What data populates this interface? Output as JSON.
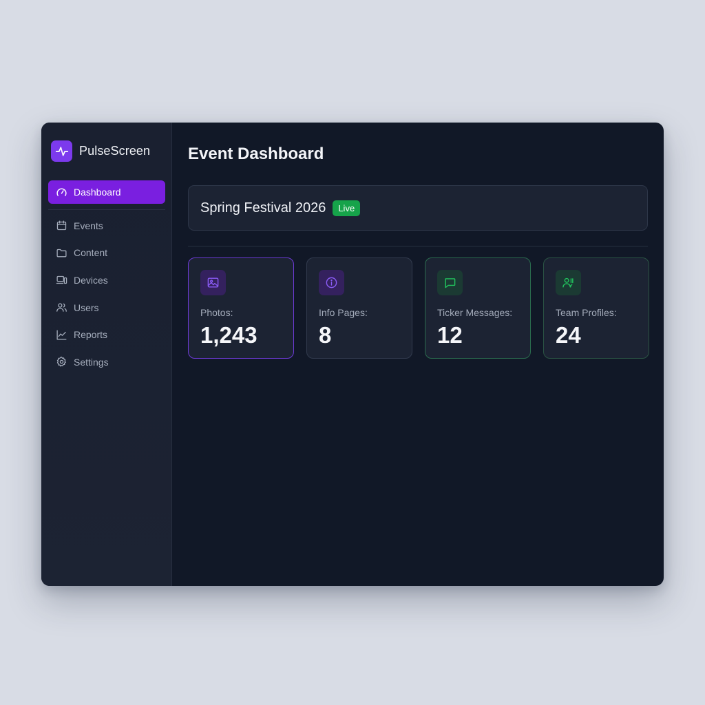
{
  "app": {
    "name": "PulseScreen",
    "logo_icon": "pulse-icon",
    "accent_color": "#7c3aed"
  },
  "sidebar": {
    "active_item": {
      "label": "Dashboard",
      "icon": "gauge-icon"
    },
    "items": [
      {
        "label": "Events",
        "icon": "calendar-icon"
      },
      {
        "label": "Content",
        "icon": "folder-icon"
      },
      {
        "label": "Devices",
        "icon": "devices-icon"
      },
      {
        "label": "Users",
        "icon": "users-icon"
      },
      {
        "label": "Reports",
        "icon": "chart-line-icon"
      },
      {
        "label": "Settings",
        "icon": "gear-icon"
      }
    ]
  },
  "main": {
    "title": "Event Dashboard",
    "event": {
      "name": "Spring Festival 2026",
      "status": "Live",
      "status_color": "#16a34a"
    },
    "stats": [
      {
        "label": "Photos:",
        "value": "1,243",
        "icon": "image-icon",
        "color": "#8b5cf6"
      },
      {
        "label": "Info Pages:",
        "value": "8",
        "icon": "info-icon",
        "color": "#8b5cf6"
      },
      {
        "label": "Ticker Messages:",
        "value": "12",
        "icon": "message-icon",
        "color": "#22c55e"
      },
      {
        "label": "Team Profiles:",
        "value": "24",
        "icon": "team-icon",
        "color": "#22c55e"
      }
    ]
  }
}
